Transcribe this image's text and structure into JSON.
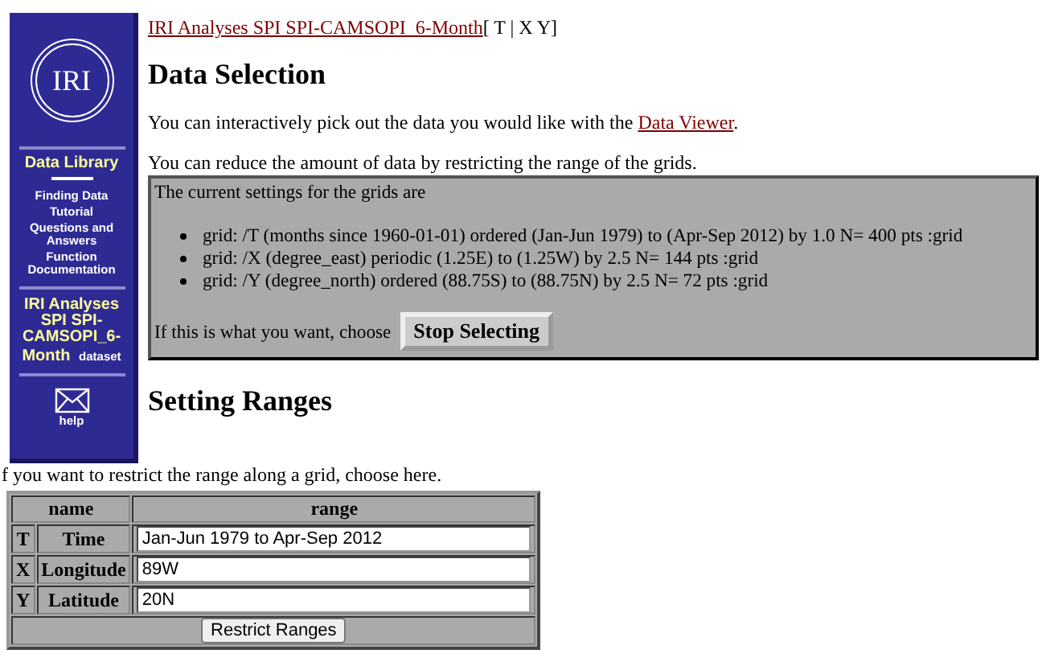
{
  "sidebar": {
    "logo": "IRI",
    "title": "Data Library",
    "links": [
      "Finding Data",
      "Tutorial",
      "Questions and Answers",
      "Function Documentation"
    ],
    "dataset": {
      "name": "IRI Analyses SPI SPI-CAMSOPI_6-Month",
      "suffix": "dataset"
    },
    "help": "help"
  },
  "breadcrumb": {
    "link": "IRI Analyses SPI SPI-CAMSOPI_6-Month",
    "suffix": "[ T | X Y]"
  },
  "data_selection": {
    "heading": "Data Selection",
    "intro": "You can interactively pick out the data you would like with the ",
    "intro_link": "Data Viewer",
    "intro_end": ".",
    "reduce": "You can reduce the amount of data by restricting the range of the grids.",
    "settings_title": "The current settings for the grids are",
    "grids": [
      "grid: /T (months since 1960-01-01) ordered (Jan-Jun 1979) to (Apr-Sep 2012) by 1.0 N= 400 pts :grid",
      "grid: /X (degree_east) periodic (1.25E) to (1.25W) by 2.5 N= 144 pts :grid",
      "grid: /Y (degree_north) ordered (88.75S) to (88.75N) by 2.5 N= 72 pts :grid"
    ],
    "choose": "If this is what you want, choose",
    "button": "Stop Selecting"
  },
  "setting_ranges": {
    "heading": "Setting Ranges",
    "intro": "f you want to restrict the range along a grid, choose here.",
    "columns": [
      "name",
      "range"
    ],
    "rows": [
      {
        "axis": "T",
        "name": "Time",
        "value": "Jan-Jun 1979 to Apr-Sep 2012"
      },
      {
        "axis": "X",
        "name": "Longitude",
        "value": "89W"
      },
      {
        "axis": "Y",
        "name": "Latitude",
        "value": "20N"
      }
    ],
    "button": "Restrict Ranges"
  }
}
